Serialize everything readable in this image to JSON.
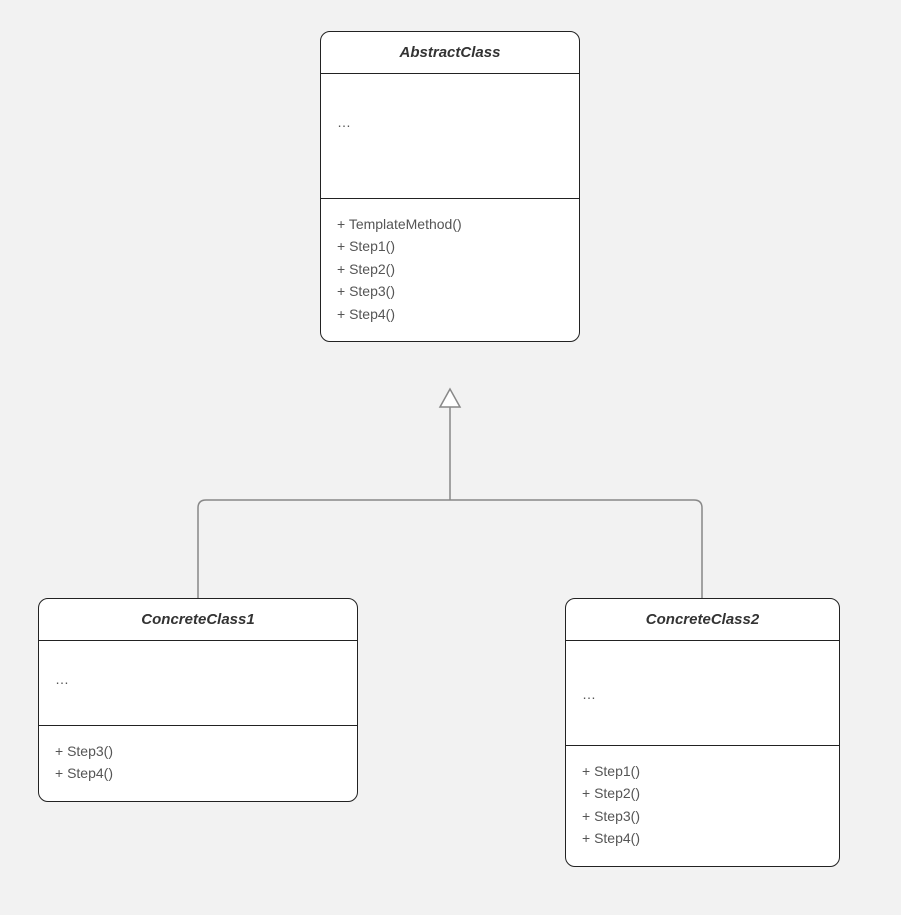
{
  "diagram": {
    "abstract": {
      "title": "AbstractClass",
      "attrs": "…",
      "methods": [
        "+ TemplateMethod()",
        "+ Step1()",
        "+ Step2()",
        "+ Step3()",
        "+ Step4()"
      ]
    },
    "concrete1": {
      "title": "ConcreteClass1",
      "attrs": "…",
      "methods": [
        "+ Step3()",
        "+ Step4()"
      ]
    },
    "concrete2": {
      "title": "ConcreteClass2",
      "attrs": "…",
      "methods": [
        "+ Step1()",
        "+ Step2()",
        "+ Step3()",
        "+ Step4()"
      ]
    }
  }
}
